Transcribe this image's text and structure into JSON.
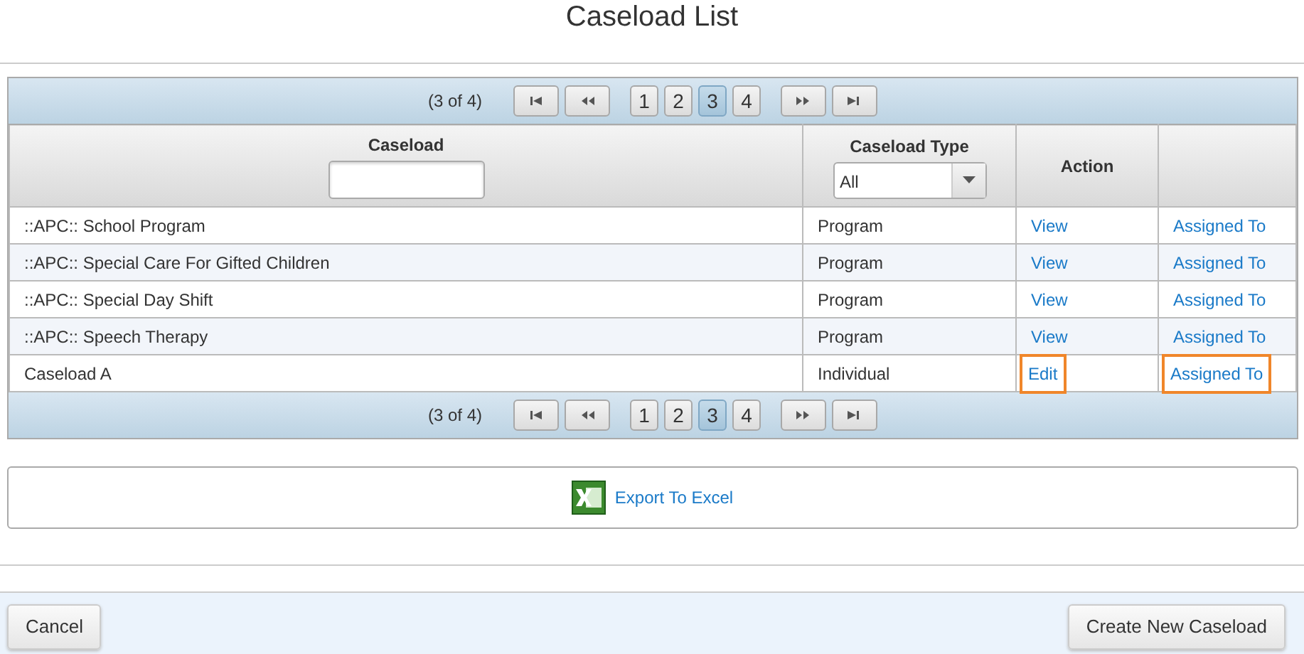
{
  "title": "Caseload List",
  "pager_top": {
    "summary": "(3 of 4)",
    "pages": [
      {
        "label": "1",
        "selected": false
      },
      {
        "label": "2",
        "selected": false
      },
      {
        "label": "3",
        "selected": true
      },
      {
        "label": "4",
        "selected": false
      }
    ]
  },
  "table": {
    "columns": [
      "Caseload",
      "Caseload Type",
      "Action"
    ],
    "filters": {
      "caseload_type": {
        "value": "All"
      }
    },
    "rows": [
      {
        "caseload": "::APC:: School Program",
        "type": "Program",
        "action": {
          "label": "View",
          "highlighted": false
        },
        "assigned": {
          "label": "Assigned To",
          "highlighted": false
        }
      },
      {
        "caseload": "::APC:: Special Care For Gifted Children",
        "type": "Program",
        "action": {
          "label": "View",
          "highlighted": false
        },
        "assigned": {
          "label": "Assigned To",
          "highlighted": false
        }
      },
      {
        "caseload": "::APC:: Special Day Shift",
        "type": "Program",
        "action": {
          "label": "View",
          "highlighted": false
        },
        "assigned": {
          "label": "Assigned To",
          "highlighted": false
        }
      },
      {
        "caseload": "::APC:: Speech Therapy",
        "type": "Program",
        "action": {
          "label": "View",
          "highlighted": false
        },
        "assigned": {
          "label": "Assigned To",
          "highlighted": false
        }
      },
      {
        "caseload": "Caseload A",
        "type": "Individual",
        "action": {
          "label": "Edit",
          "highlighted": true
        },
        "assigned": {
          "label": "Assigned To",
          "highlighted": true
        }
      }
    ]
  },
  "pager_bottom": {
    "summary": "(3 of 4)",
    "pages": [
      {
        "label": "1",
        "selected": false
      },
      {
        "label": "2",
        "selected": false
      },
      {
        "label": "3",
        "selected": true
      },
      {
        "label": "4",
        "selected": false
      }
    ]
  },
  "export": {
    "label": "Export To Excel"
  },
  "buttons": [
    {
      "label": "Cancel",
      "kind": "cancel"
    },
    {
      "label": "Create New Caseload",
      "kind": "create"
    }
  ]
}
